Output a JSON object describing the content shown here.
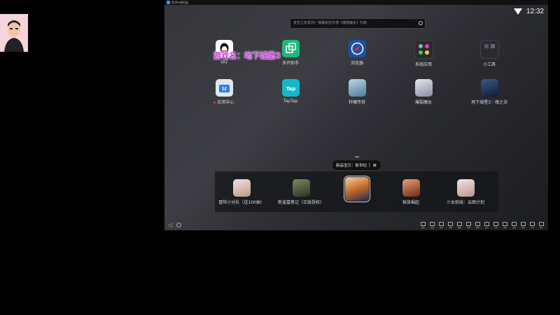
{
  "emulator": {
    "title": "MuMu模拟器",
    "clock": "12:32",
    "search_placeholder": "有生之年系列！弹幕射击手游《爆裂魔女》归来"
  },
  "watermark_text": "游戏名：地下城堡3",
  "desktop_apps": [
    {
      "label": "QQ",
      "icon": "qq-penguin-icon",
      "color": "#ffffff",
      "badge": false
    },
    {
      "label": "多开助手",
      "icon": "multi-open-icon",
      "color": "#1fb97c",
      "badge": false
    },
    {
      "label": "浏览器",
      "icon": "compass-icon",
      "color": "#1e4fa0",
      "badge": false
    },
    {
      "label": "系统应用",
      "icon": "system-apps-folder-icon",
      "color": "#2a2a30",
      "badge": false
    },
    {
      "label": "小工具",
      "icon": "tools-folder-icon",
      "color": "#2a2a30",
      "badge": false
    },
    {
      "label": "应用中心",
      "icon": "app-center-icon",
      "color": "#dfe6ee",
      "badge": true
    },
    {
      "label": "TapTap",
      "icon": "taptap-icon",
      "color": "#14b9c8",
      "badge": false
    },
    {
      "label": "轩辕传奇",
      "icon": "xuanyuan-game-icon",
      "color": "#6ba0b8",
      "badge": false
    },
    {
      "label": "爆裂魔女",
      "icon": "witch-game-icon",
      "color": "#c9c9d6",
      "badge": false
    },
    {
      "label": "地下城堡3：魂之诗",
      "icon": "dungeon-castle-game-icon",
      "color": "#1d2f55",
      "badge": false
    }
  ],
  "recommend_tooltip": {
    "text": "新品宝贝：新世纪",
    "separator": "|"
  },
  "dock_apps": [
    {
      "label": "冒险小分队（送100抽）",
      "icon": "adventure-team-game-icon",
      "color": "#d9c4b8",
      "selected": false
    },
    {
      "label": "新盗墓笔记（正版授权）",
      "icon": "tomb-notes-game-icon",
      "color": "#4a5540",
      "selected": false
    },
    {
      "label": "",
      "icon": "new-century-game-icon",
      "color": "#c46a2a",
      "selected": true
    },
    {
      "label": "致族崛起",
      "icon": "rise-game-icon",
      "color": "#b4563a",
      "selected": false
    },
    {
      "label": "少女前线：云图计划",
      "icon": "girls-frontline-game-icon",
      "color": "#d8c6c0",
      "selected": false
    }
  ],
  "toolbar_tools": [
    "键盘",
    "全屏",
    "多开",
    "录屏",
    "截图",
    "音量",
    "震动",
    "定位",
    "共享",
    "旋转",
    "设置",
    "更多",
    "关闭",
    "最小"
  ]
}
